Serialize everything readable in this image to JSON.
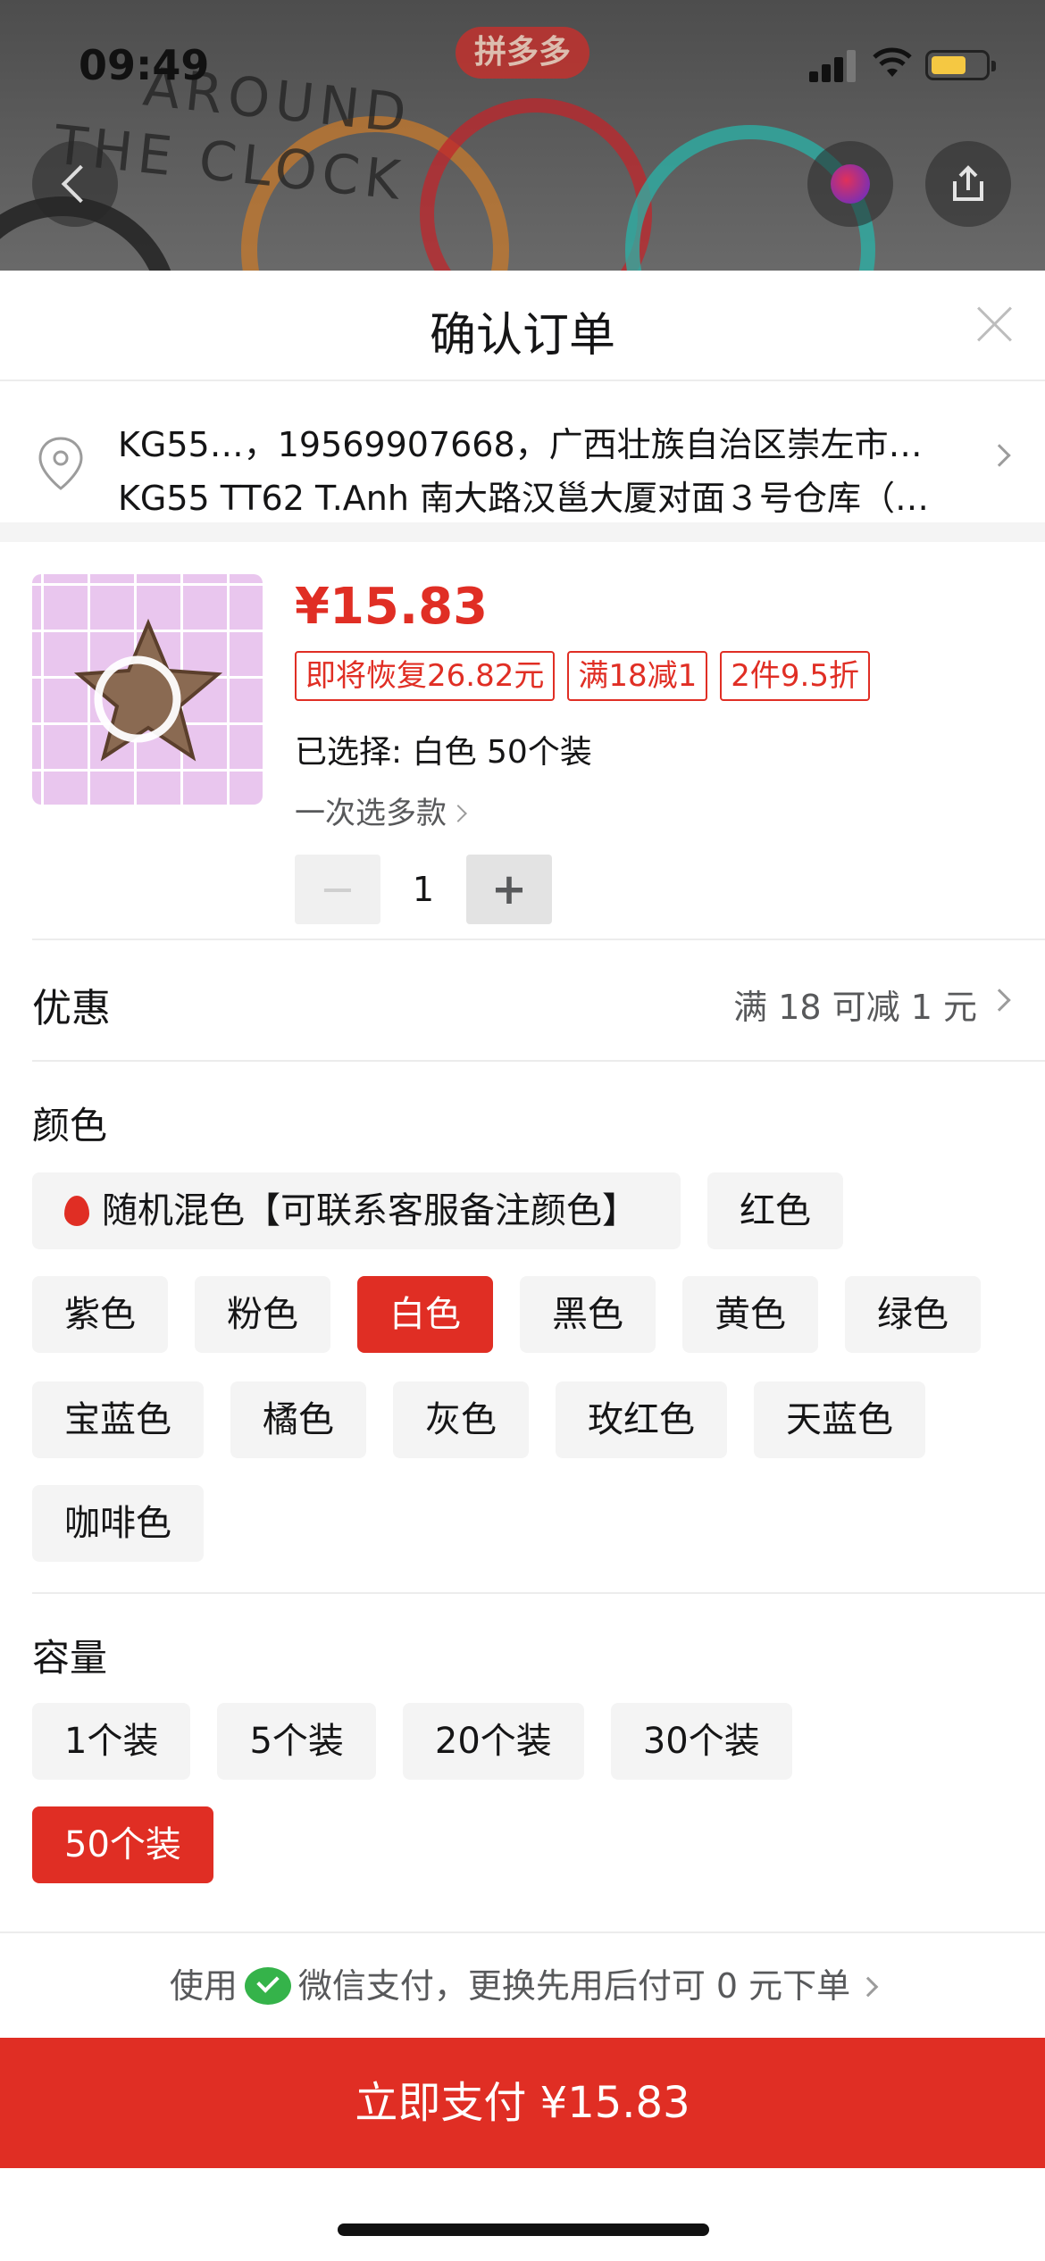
{
  "status_bar": {
    "time": "09:49"
  },
  "background": {
    "app_badge": "拼多多",
    "print_line1": "AROUND",
    "print_line2": "THE CLOCK"
  },
  "sheet": {
    "title": "确认订单",
    "address": {
      "line1": "KG55…，19569907668，广西壮族自治区崇左市…",
      "line2": "KG55 TT62 T.Anh 南大路汉邕大厦对面３号仓库（…"
    },
    "product": {
      "price": "¥15.83",
      "tags": [
        "即将恢复26.82元",
        "满18减1",
        "2件9.5折"
      ],
      "selected": "已选择: 白色 50个装",
      "multi_select": "一次选多款",
      "quantity": "1",
      "minus": "−",
      "plus": "+"
    },
    "promo": {
      "label": "优惠",
      "value": "满 18 可减 1 元"
    },
    "color": {
      "title": "颜色",
      "options": [
        "随机混色【可联系客服备注颜色】",
        "红色",
        "紫色",
        "粉色",
        "白色",
        "黑色",
        "黄色",
        "绿色",
        "宝蓝色",
        "橘色",
        "灰色",
        "玫红色",
        "天蓝色",
        "咖啡色"
      ],
      "selected": "白色"
    },
    "capacity": {
      "title": "容量",
      "options": [
        "1个装",
        "5个装",
        "20个装",
        "30个装",
        "50个装"
      ],
      "selected": "50个装"
    },
    "payment_tip": {
      "prefix": "使用",
      "method": "微信支付，更换先用后付可 0 元下单"
    },
    "pay_button": "立即支付 ¥15.83"
  },
  "colors": {
    "accent": "#e02e24",
    "chip_bg": "#f4f4f4",
    "wechat": "#35b34a"
  }
}
